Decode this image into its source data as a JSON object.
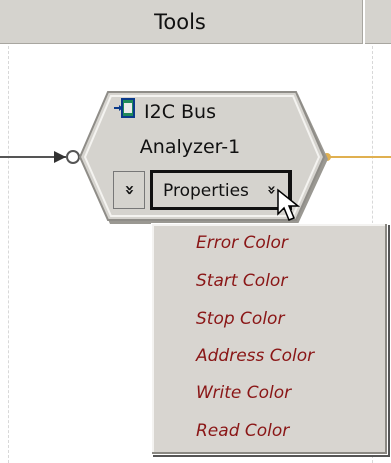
{
  "header": {
    "title": "Tools"
  },
  "node": {
    "title_line1": "I2C Bus",
    "title_line2": "Analyzer-1",
    "expand_glyph": "»",
    "properties_label": "Properties",
    "properties_chevron": "»",
    "icon": "module-icon",
    "input_connector_color": "#555555",
    "output_connector_color": "#e0b050"
  },
  "menu": {
    "items": [
      {
        "label": "Error Color"
      },
      {
        "label": "Start Color"
      },
      {
        "label": "Stop Color"
      },
      {
        "label": "Address Color"
      },
      {
        "label": "Write Color"
      },
      {
        "label": "Read Color"
      }
    ],
    "text_color": "#8a1616"
  },
  "colors": {
    "panel": "#d5d3ce",
    "canvas": "#ffffff"
  }
}
